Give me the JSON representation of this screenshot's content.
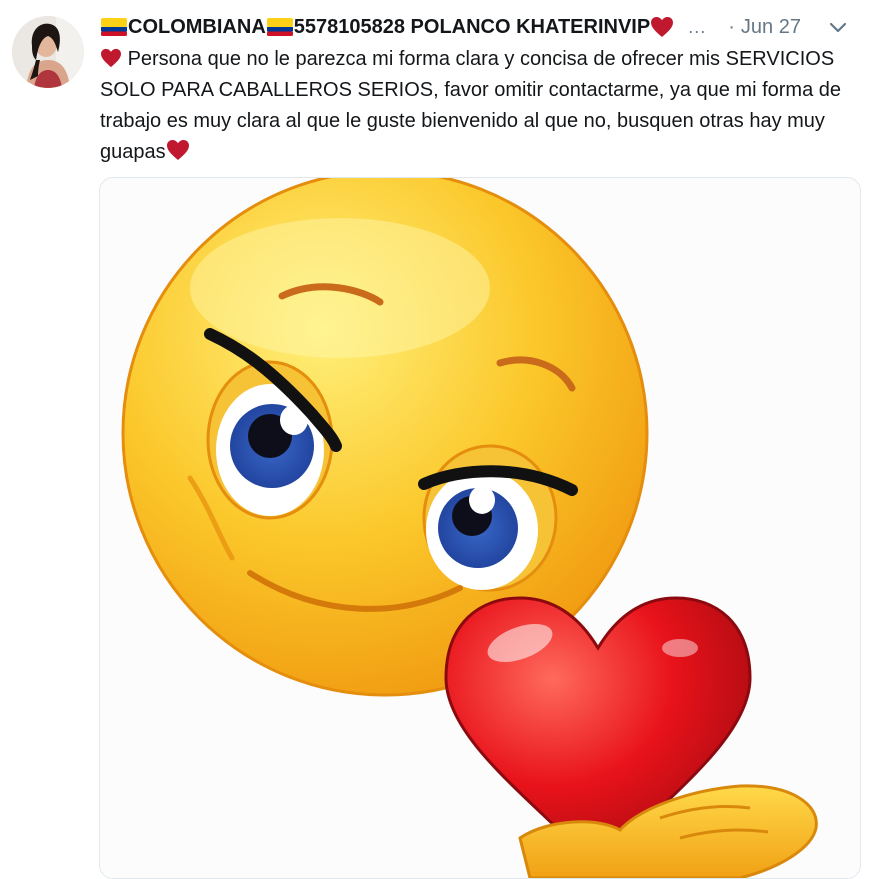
{
  "tweet": {
    "display_name_part1": "COLOMBIANA",
    "display_name_part2": "5578105828 POLANCO KHATERINVIP",
    "ellipsis": "...",
    "separator": "·",
    "date": "Jun 27",
    "text": "Persona que no le parezca mi forma clara y concisa de ofrecer mis SERVICIOS SOLO PARA CABALLEROS SERIOS, favor omitir contactarme, ya que mi forma de trabajo es muy clara al que le guste bienvenido al que no, busquen otras hay muy guapas"
  },
  "icons": {
    "flag": "colombia-flag-icon",
    "heart": "red-heart-icon",
    "caret": "chevron-down-icon"
  },
  "colors": {
    "heart": "#c0182f",
    "muted": "#657786",
    "border": "#e1e8ed",
    "emoji_yellow": "#f6b319",
    "heart_red": "#e8121a"
  }
}
